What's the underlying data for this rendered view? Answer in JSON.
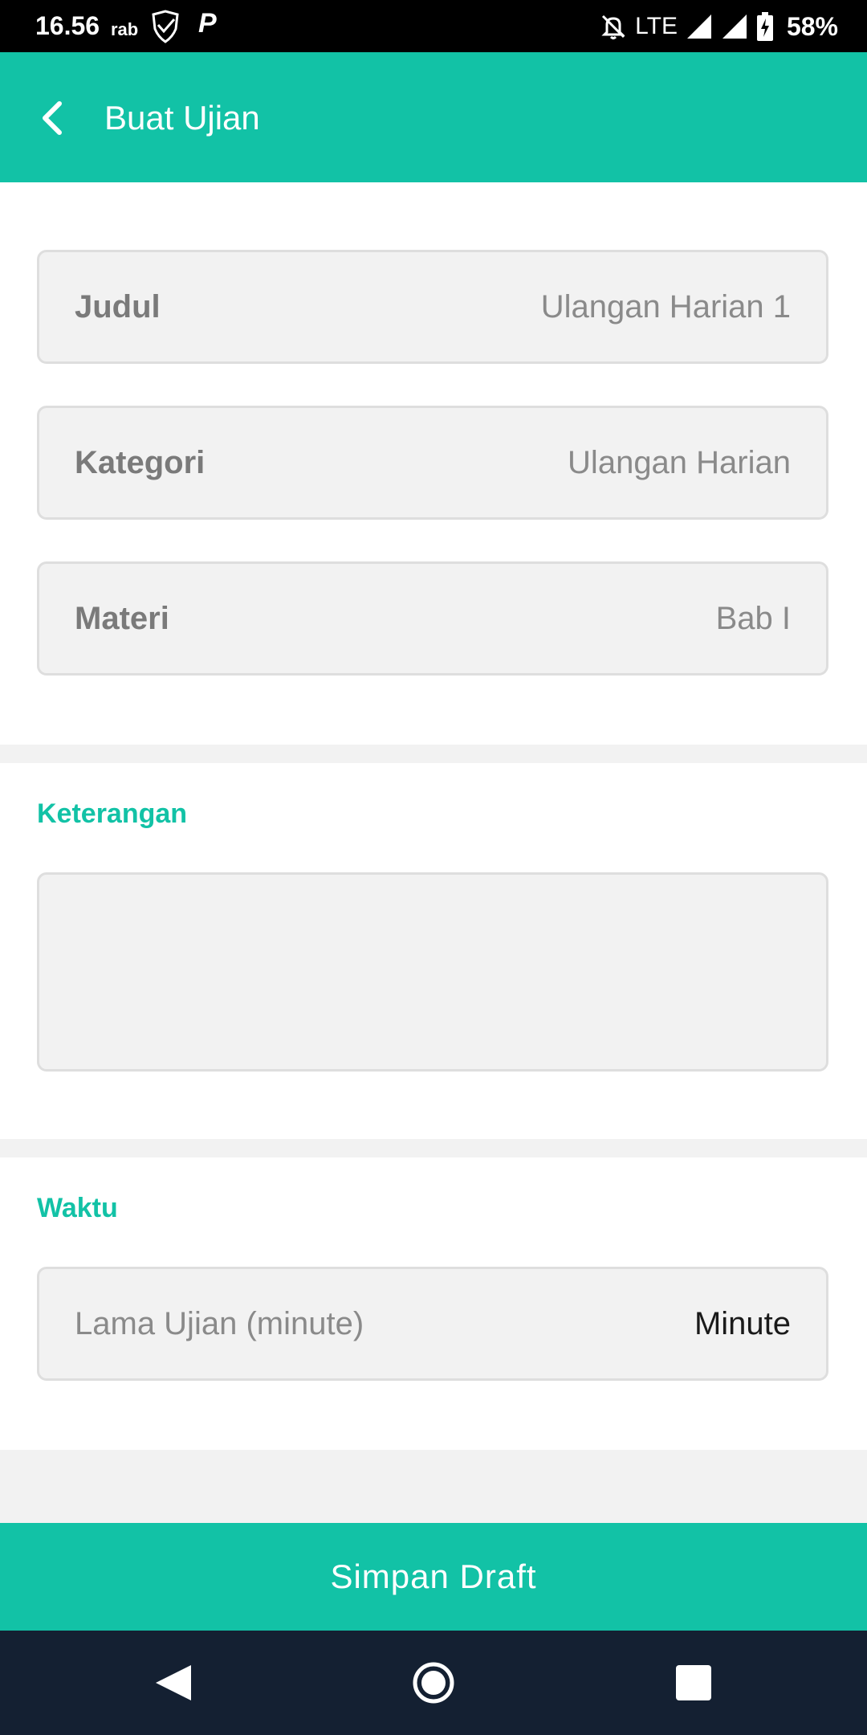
{
  "status_bar": {
    "time": "16.56",
    "day": "rab",
    "network": "LTE",
    "battery": "58%"
  },
  "app_bar": {
    "title": "Buat Ujian",
    "back_icon": "chevron-left-icon"
  },
  "form": {
    "judul": {
      "label": "Judul",
      "value": "Ulangan Harian 1"
    },
    "kategori": {
      "label": "Kategori",
      "value": "Ulangan Harian"
    },
    "materi": {
      "label": "Materi",
      "value": "Bab I"
    }
  },
  "keterangan": {
    "label": "Keterangan",
    "value": ""
  },
  "waktu": {
    "label": "Waktu",
    "lama_ujian": {
      "label": "Lama Ujian (minute)",
      "value": "Minute"
    }
  },
  "save_button": {
    "label": "Simpan Draft"
  },
  "colors": {
    "accent": "#12c2a6",
    "nav_bg": "#142032",
    "field_bg": "#f2f2f2"
  }
}
